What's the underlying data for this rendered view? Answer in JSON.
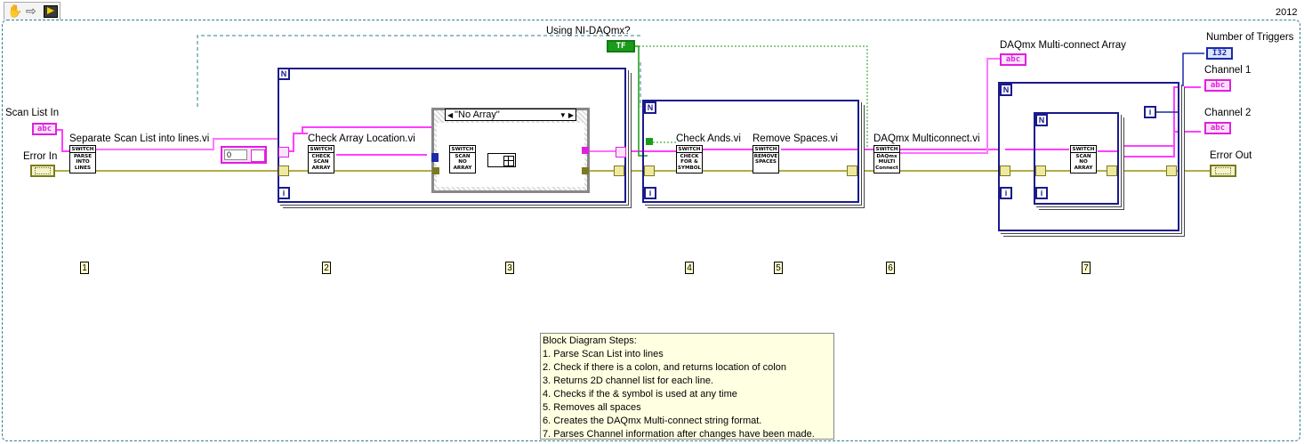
{
  "toolbar": {
    "version_label": "2012",
    "icons": [
      "hand-icon",
      "arrow-right-icon",
      "highlight-execution-icon"
    ]
  },
  "labels": {
    "scan_list_in": "Scan List In",
    "error_in": "Error In",
    "separate_vi": "Separate Scan List into lines.vi",
    "check_array_vi": "Check Array Location.vi",
    "using_daqmx": "Using NI-DAQmx?",
    "check_ands_vi": "Check Ands.vi",
    "remove_spaces_vi": "Remove Spaces.vi",
    "daqmx_multiconnect_vi": "DAQmx Multiconnect.vi",
    "daqmx_array": "DAQmx Multi-connect Array",
    "number_of_triggers": "Number of Triggers",
    "channel_1": "Channel 1",
    "channel_2": "Channel 2",
    "error_out": "Error Out"
  },
  "terminals": {
    "str_text": "abc",
    "err_text": "",
    "bool_text": "TF",
    "i32_text": "I32",
    "const_zero": "0"
  },
  "loops": {
    "n": "N",
    "i": "i",
    "case_selector": "\"No Array\""
  },
  "subvis": {
    "parse": {
      "head": "SWITCH",
      "body": "PARSE INTO LINES"
    },
    "check_scan": {
      "head": "SWITCH",
      "body": "CHECK SCAN ARRAY"
    },
    "scan_no_array": {
      "head": "SWITCH",
      "body": "SCAN NO ARRAY"
    },
    "check_ands": {
      "head": "SWITCH",
      "body": "CHECK FOR & SYMBOL"
    },
    "remove_spaces": {
      "head": "SWITCH",
      "body": "REMOVE SPACES"
    },
    "multi_connect": {
      "head": "SWITCH",
      "body": "DAQmx MULTI Connect"
    },
    "scan_no_array2": {
      "head": "SWITCH",
      "body": "SCAN NO ARRAY"
    }
  },
  "steps": [
    "1",
    "2",
    "3",
    "4",
    "5",
    "6",
    "7"
  ],
  "notes": {
    "title": "Block Diagram Steps:",
    "lines": [
      "1. Parse Scan List into lines",
      "2. Check if there is a colon, and returns location of colon",
      "3. Returns 2D channel list for each line.",
      "4. Checks if the & symbol is used at any time",
      "5. Removes all spaces",
      "6. Creates the DAQmx Multi-connect string format.",
      "7. Parses Channel information after changes have been made."
    ]
  },
  "colors": {
    "string_wire": "#ff40ff",
    "error_wire": "#7a7a20",
    "bool_wire": "#1a9c1a",
    "int_wire": "#1a2aa8",
    "loop_border": "#1a1a8c",
    "diagram_border": "#2f7f8f"
  }
}
